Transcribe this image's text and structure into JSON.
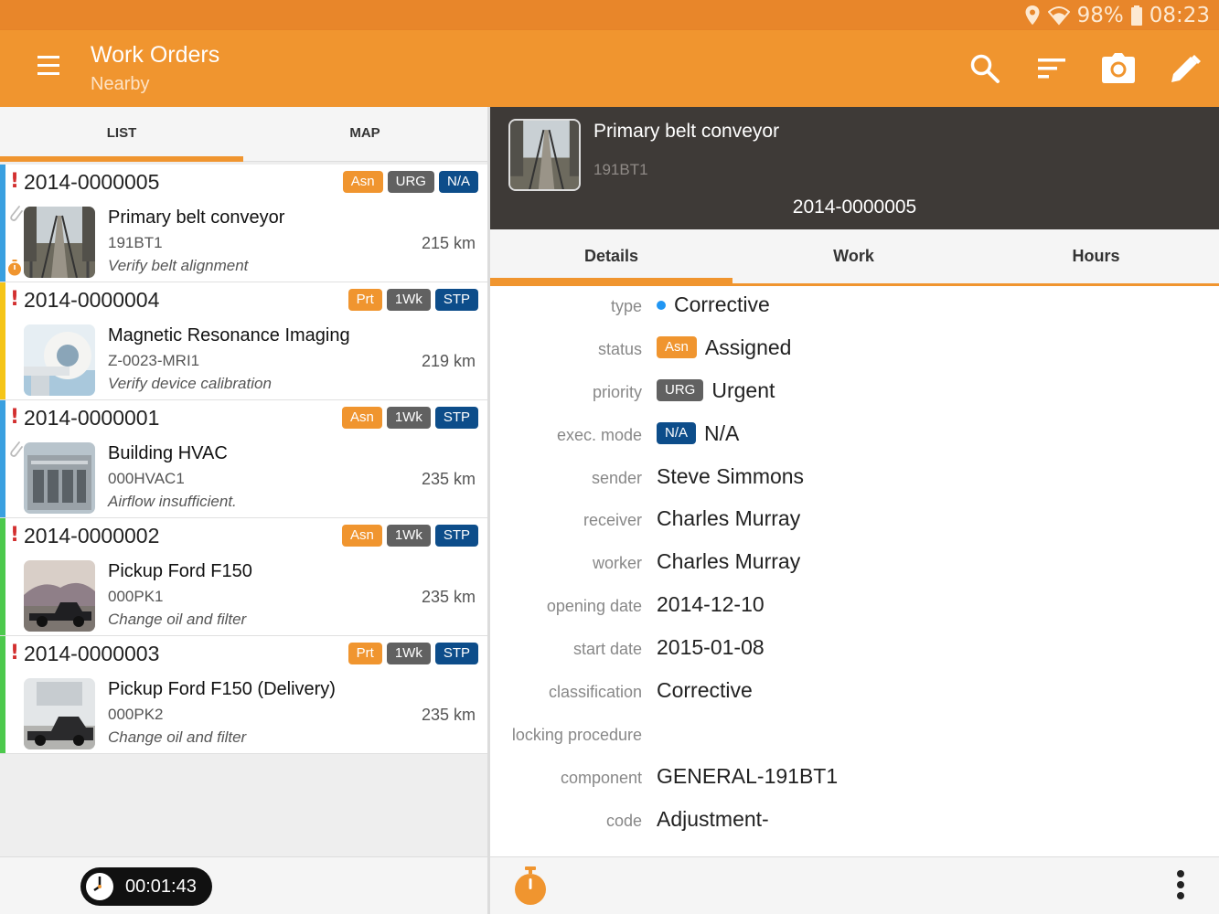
{
  "status_bar": {
    "battery": "98%",
    "time": "08:23",
    "icons": [
      "location-icon",
      "wifi-icon",
      "battery-icon"
    ]
  },
  "app_bar": {
    "title": "Work Orders",
    "subtitle": "Nearby",
    "icons": [
      "menu-icon",
      "search-icon",
      "sort-icon",
      "camera-icon",
      "edit-icon"
    ]
  },
  "left_tabs": [
    "LIST",
    "MAP"
  ],
  "work_orders": [
    {
      "number": "2014-0000005",
      "badges": [
        "Asn",
        "URG",
        "N/A"
      ],
      "name": "Primary belt conveyor",
      "code": "191BT1",
      "distance": "215 km",
      "desc": "Verify belt alignment",
      "bar_color": "#3aa0e0"
    },
    {
      "number": "2014-0000004",
      "badges": [
        "Prt",
        "1Wk",
        "STP"
      ],
      "name": "Magnetic Resonance Imaging",
      "code": "Z-0023-MRI1",
      "distance": "219 km",
      "desc": "Verify device calibration",
      "bar_color": "#f5c518"
    },
    {
      "number": "2014-0000001",
      "badges": [
        "Asn",
        "1Wk",
        "STP"
      ],
      "name": "Building HVAC",
      "code": "000HVAC1",
      "distance": "235 km",
      "desc": "Airflow insufficient.",
      "bar_color": "#3aa0e0"
    },
    {
      "number": "2014-0000002",
      "badges": [
        "Asn",
        "1Wk",
        "STP"
      ],
      "name": "Pickup Ford F150",
      "code": "000PK1",
      "distance": "235 km",
      "desc": "Change oil and filter",
      "bar_color": "#4cc94c"
    },
    {
      "number": "2014-0000003",
      "badges": [
        "Prt",
        "1Wk",
        "STP"
      ],
      "name": "Pickup Ford F150 (Delivery)",
      "code": "000PK2",
      "distance": "235 km",
      "desc": "Change oil and filter",
      "bar_color": "#4cc94c"
    }
  ],
  "timer": {
    "value": "00:01:43"
  },
  "detail_header": {
    "title": "Primary belt conveyor",
    "code": "191BT1",
    "number": "2014-0000005"
  },
  "detail_tabs": [
    "Details",
    "Work",
    "Hours"
  ],
  "details": [
    {
      "label": "type",
      "value": "Corrective",
      "dot": true
    },
    {
      "label": "status",
      "value": "Assigned",
      "badge": "Asn",
      "badge_color": "#f0952f"
    },
    {
      "label": "priority",
      "value": "Urgent",
      "badge": "URG",
      "badge_color": "#616161"
    },
    {
      "label": "exec. mode",
      "value": "N/A",
      "badge": "N/A",
      "badge_color": "#0d4d8a"
    },
    {
      "label": "sender",
      "value": "Steve Simmons"
    },
    {
      "label": "receiver",
      "value": "Charles Murray"
    },
    {
      "label": "worker",
      "value": "Charles Murray"
    },
    {
      "label": "opening date",
      "value": "2014-12-10"
    },
    {
      "label": "start date",
      "value": "2015-01-08"
    },
    {
      "label": "classification",
      "value": "Corrective"
    },
    {
      "label": "locking procedure",
      "value": ""
    },
    {
      "label": "component",
      "value": "GENERAL-191BT1"
    },
    {
      "label": "code",
      "value": "Adjustment-"
    }
  ],
  "colors": {
    "accent": "#f0952f",
    "header_dark": "#3e3a37",
    "urgent_gray": "#616161",
    "stp_blue": "#0d4d8a"
  }
}
